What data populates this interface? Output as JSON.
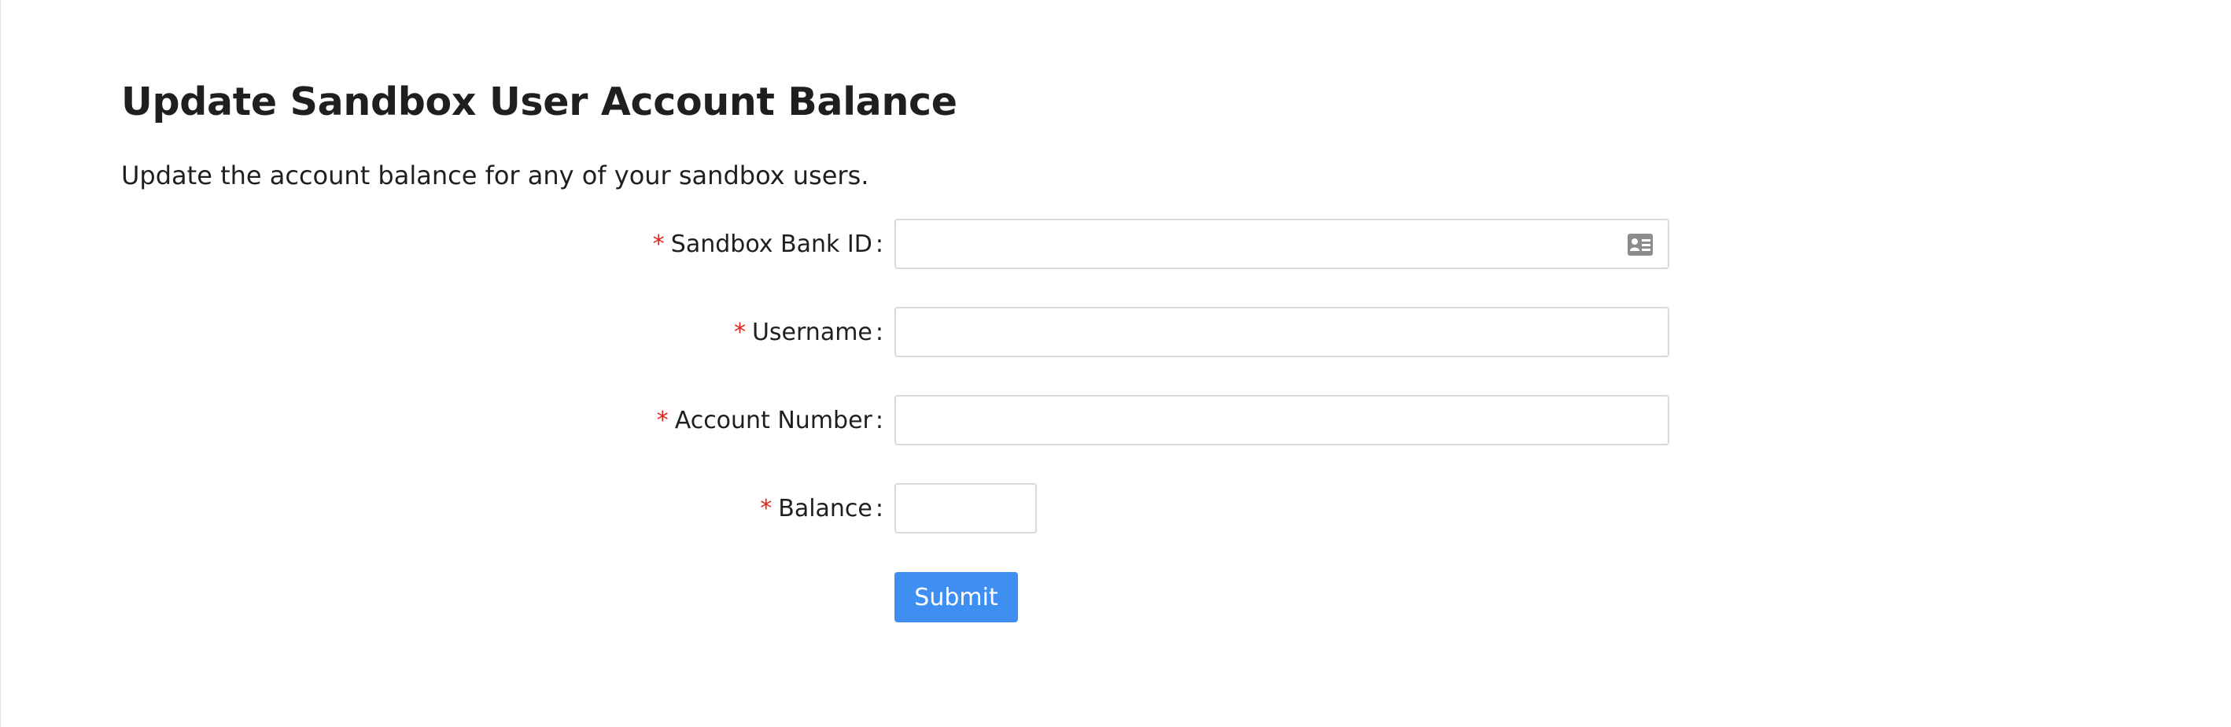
{
  "page": {
    "title": "Update Sandbox User Account Balance",
    "subtitle": "Update the account balance for any of your sandbox users."
  },
  "form": {
    "required_marker": "*",
    "label_separator": ":",
    "fields": [
      {
        "label": "Sandbox Bank ID",
        "value": "",
        "placeholder": "",
        "icon": "id-card-icon"
      },
      {
        "label": "Username",
        "value": "",
        "placeholder": ""
      },
      {
        "label": "Account Number",
        "value": "",
        "placeholder": ""
      },
      {
        "label": "Balance",
        "value": "",
        "placeholder": ""
      }
    ],
    "submit_label": "Submit"
  },
  "colors": {
    "primary": "#3f8ff2",
    "required": "#e2231a",
    "border": "#d9d9d9",
    "icon": "#8c8c8c",
    "text": "#1f1f1f"
  }
}
